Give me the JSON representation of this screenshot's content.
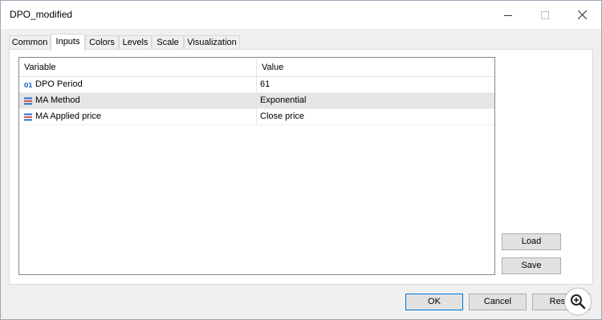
{
  "window": {
    "title": "DPO_modified"
  },
  "window_controls": {
    "minimize": "minimize-icon",
    "maximize": "maximize-icon",
    "close": "close-icon"
  },
  "tabs": [
    {
      "label": "Common",
      "active": false
    },
    {
      "label": "Inputs",
      "active": true
    },
    {
      "label": "Colors",
      "active": false
    },
    {
      "label": "Levels",
      "active": false
    },
    {
      "label": "Scale",
      "active": false
    },
    {
      "label": "Visualization",
      "active": false
    }
  ],
  "table": {
    "columns": [
      "Variable",
      "Value"
    ],
    "rows": [
      {
        "icon": "integer-icon",
        "icon_text": "01",
        "variable": "DPO Period",
        "value": "61",
        "selected": false
      },
      {
        "icon": "enum-list-icon",
        "variable": "MA Method",
        "value": "Exponential",
        "selected": true
      },
      {
        "icon": "enum-list-icon",
        "variable": "MA Applied price",
        "value": "Close price",
        "selected": false
      }
    ]
  },
  "side_buttons": {
    "load": "Load",
    "save": "Save"
  },
  "footer_buttons": {
    "ok": "OK",
    "cancel": "Cancel",
    "reset": "Reset"
  },
  "colors": {
    "accent": "#0078d7",
    "selected_row": "#e5e5e5",
    "integer_icon": "#2b6cc4",
    "enum_icon_red": "#d9534f",
    "enum_icon_blue": "#2b6cc4"
  }
}
